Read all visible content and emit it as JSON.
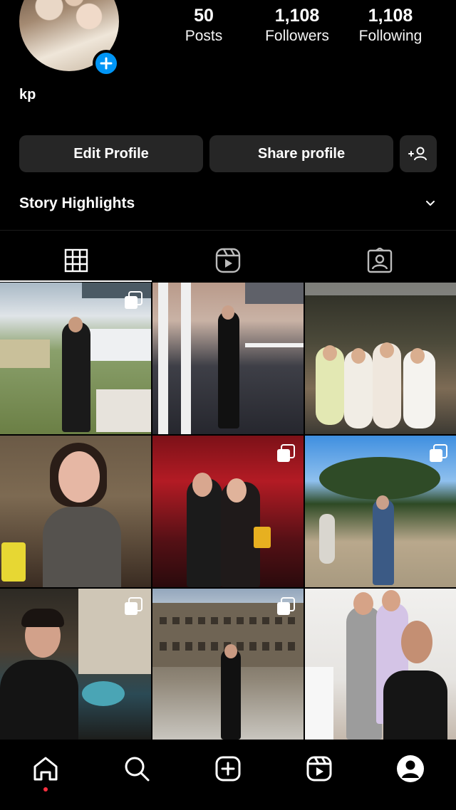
{
  "profile": {
    "username": "kp",
    "stats": [
      {
        "value": "50",
        "label": "Posts"
      },
      {
        "value": "1,108",
        "label": "Followers"
      },
      {
        "value": "1,108",
        "label": "Following"
      }
    ]
  },
  "actions": {
    "edit_profile": "Edit Profile",
    "share_profile": "Share profile"
  },
  "highlights": {
    "label": "Story Highlights"
  },
  "tabs": [
    {
      "icon": "grid-icon",
      "active": true
    },
    {
      "icon": "reels-icon",
      "active": false
    },
    {
      "icon": "tagged-icon",
      "active": false
    }
  ],
  "posts": [
    {
      "multi": true
    },
    {
      "multi": false
    },
    {
      "multi": false
    },
    {
      "multi": false
    },
    {
      "multi": true
    },
    {
      "multi": true
    },
    {
      "multi": true
    },
    {
      "multi": true
    },
    {
      "multi": false
    }
  ],
  "bottom_nav": [
    "home-icon",
    "search-icon",
    "create-icon",
    "reels-icon",
    "profile-icon"
  ],
  "colors": {
    "background": "#000000",
    "button_bg": "#262626",
    "accent_blue": "#0095f6",
    "notification_dot": "#ff3040"
  }
}
